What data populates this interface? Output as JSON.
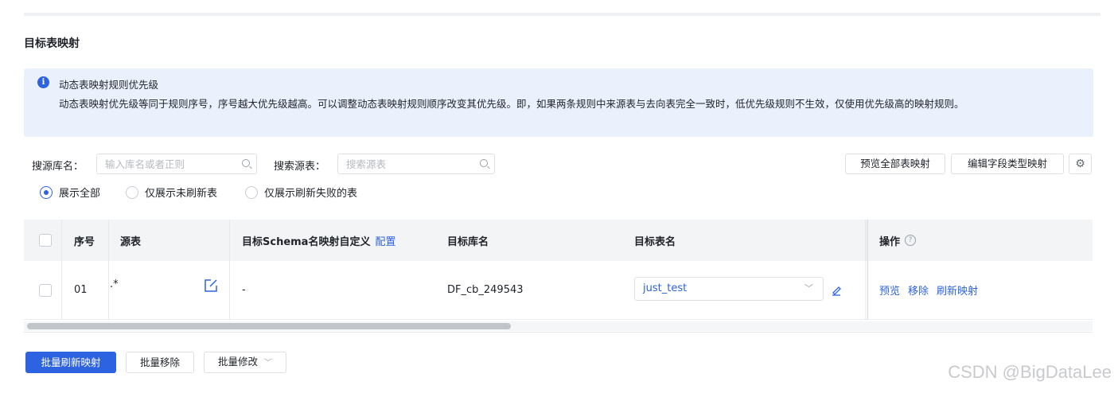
{
  "section": {
    "title": "目标表映射"
  },
  "alert": {
    "title": "动态表映射规则优先级",
    "description": "动态表映射优先级等同于规则序号，序号越大优先级越高。可以调整动态表映射规则顺序改变其优先级。即，如果两条规则中来源表与去向表完全一致时，低优先级规则不生效，仅使用优先级高的映射规则。"
  },
  "filters": {
    "source_db_label": "搜源库名：",
    "source_db_placeholder": "输入库名或者正则",
    "source_table_label": "搜索源表：",
    "source_table_placeholder": "搜索源表"
  },
  "toolbar": {
    "preview_all_label": "预览全部表映射",
    "edit_field_type_label": "编辑字段类型映射"
  },
  "radios": [
    {
      "label": "展示全部",
      "checked": true
    },
    {
      "label": "仅展示未刷新表",
      "checked": false
    },
    {
      "label": "仅展示刷新失败的表",
      "checked": false
    }
  ],
  "table": {
    "headers": {
      "seq": "序号",
      "source": "源表",
      "schema": "目标Schema名映射自定义",
      "schema_config": "配置",
      "target_db": "目标库名",
      "target_table": "目标表名",
      "actions": "操作"
    },
    "rows": [
      {
        "seq": "01",
        "source": ".*",
        "schema": "-",
        "target_db": "DF_cb_249543",
        "target_table": "just_test",
        "actions": [
          "预览",
          "移除",
          "刷新映射"
        ]
      }
    ]
  },
  "bulk": {
    "refresh_label": "批量刷新映射",
    "remove_label": "批量移除",
    "modify_label": "批量修改"
  },
  "watermark": "CSDN @BigDataLee",
  "colors": {
    "accent": "#2d63e0",
    "alert_bg": "#eaf0fc"
  }
}
